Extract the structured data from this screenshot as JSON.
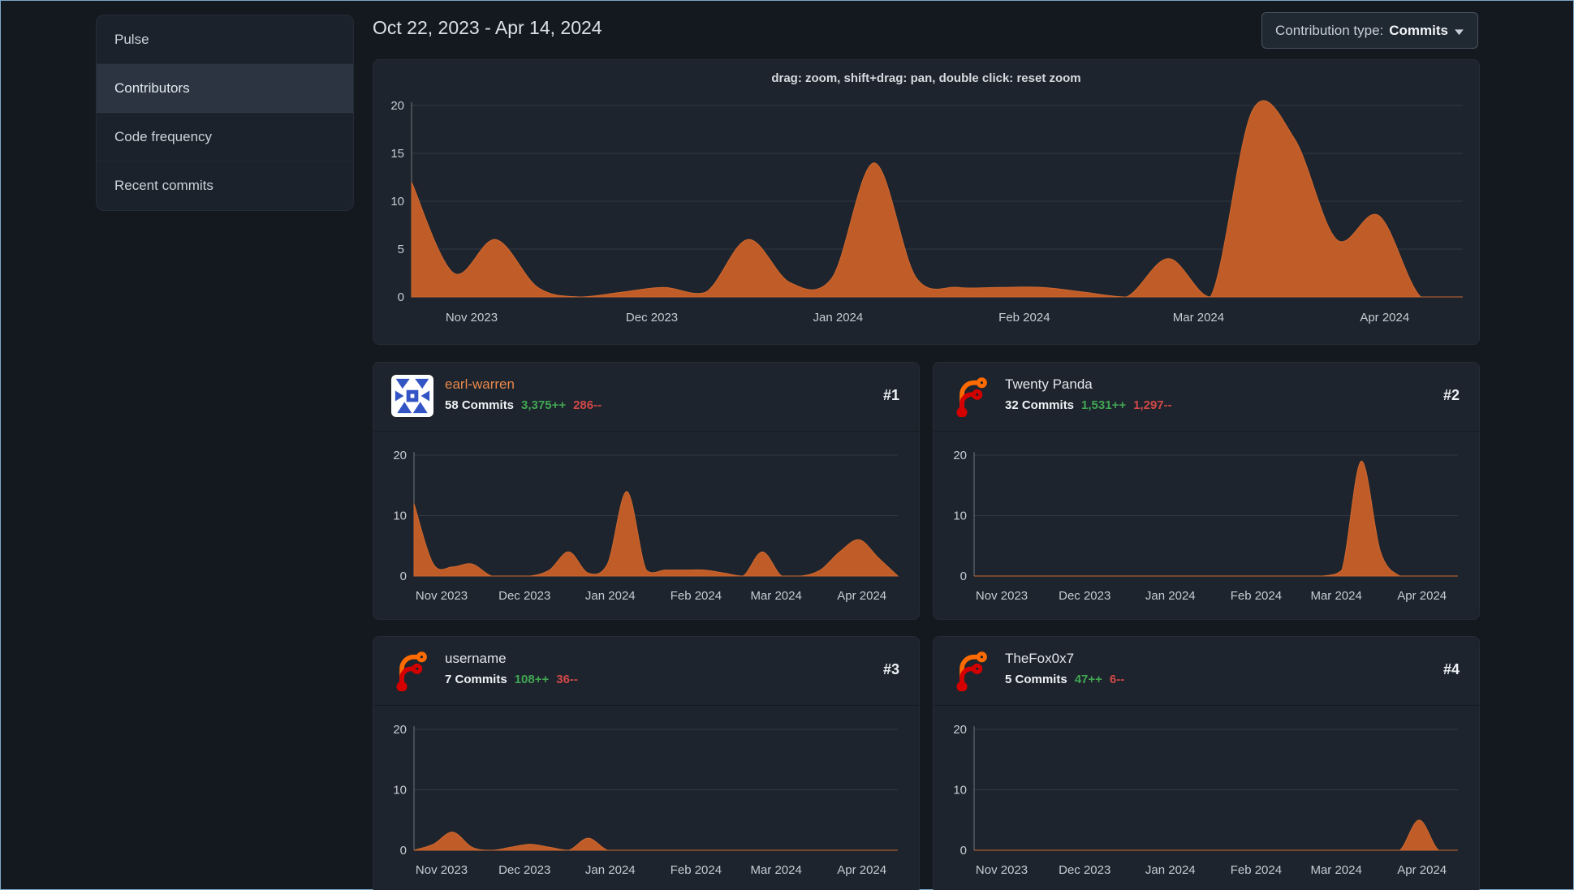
{
  "header": {
    "date_range": "Oct 22, 2023 - Apr 14, 2024",
    "contribution_type": {
      "label": "Contribution type:",
      "value": "Commits"
    }
  },
  "sidebar": {
    "items": [
      {
        "label": "Pulse",
        "active": false
      },
      {
        "label": "Contributors",
        "active": true
      },
      {
        "label": "Code frequency",
        "active": false
      },
      {
        "label": "Recent commits",
        "active": false
      }
    ]
  },
  "colors": {
    "area_fill": "#c05c28",
    "area_line": "#cd6830",
    "grid_line": "rgba(234,238,243,0.10)",
    "axis_line": "rgba(234,238,243,0.40)",
    "tick_text": "#c6ccd3",
    "additions_green": "#41a653",
    "deletions_red": "#d24848",
    "owner_link_orange": "#e9884b",
    "username_text": "#e2e6eb"
  },
  "chart_data": {
    "type": "area",
    "ylim": [
      0,
      20
    ],
    "x_axis_weeks": [
      "Oct 22",
      "Oct 29",
      "Nov 5",
      "Nov 12",
      "Nov 19",
      "Nov 26",
      "Dec 3",
      "Dec 10",
      "Dec 17",
      "Dec 24",
      "Dec 31",
      "Jan 7",
      "Jan 14",
      "Jan 21",
      "Jan 28",
      "Feb 4",
      "Feb 11",
      "Feb 18",
      "Feb 25",
      "Mar 3",
      "Mar 10",
      "Mar 17",
      "Mar 24",
      "Mar 31",
      "Apr 7",
      "Apr 14"
    ],
    "xlabels": [
      {
        "label": "Nov 2023",
        "f": 0.0571
      },
      {
        "label": "Dec 2023",
        "f": 0.2286
      },
      {
        "label": "Jan 2024",
        "f": 0.4057
      },
      {
        "label": "Feb 2024",
        "f": 0.5829
      },
      {
        "label": "Mar 2024",
        "f": 0.7486
      },
      {
        "label": "Apr 2024",
        "f": 0.9257
      }
    ],
    "main": {
      "title": "drag: zoom, shift+drag: pan, double click: reset zoom",
      "yticks": [
        0,
        5,
        10,
        15,
        20
      ],
      "values": [
        12,
        2.5,
        6,
        1,
        0,
        0.5,
        1,
        0.5,
        6,
        1.5,
        2,
        14,
        2,
        1,
        1,
        1,
        0.5,
        0,
        4,
        0,
        19.5,
        16.5,
        6,
        8.5,
        0,
        0
      ]
    },
    "contributors": [
      {
        "rank": "#1",
        "name": "earl-warren",
        "name_color": "#e9884b",
        "avatar": "identicon",
        "commits": "58 Commits",
        "additions": "3,375++",
        "deletions": "286--",
        "yticks": [
          0,
          10,
          20
        ],
        "values": [
          12,
          2,
          1.5,
          2,
          0,
          0,
          0,
          1,
          4,
          0.5,
          2,
          14,
          1,
          1,
          1,
          1,
          0.5,
          0,
          4,
          0,
          0,
          1,
          4,
          6,
          3,
          0
        ]
      },
      {
        "rank": "#2",
        "name": "Twenty Panda",
        "name_color": "#e2e6eb",
        "avatar": "forgejo",
        "commits": "32 Commits",
        "additions": "1,531++",
        "deletions": "1,297--",
        "yticks": [
          0,
          10,
          20
        ],
        "values": [
          0,
          0,
          0,
          0,
          0,
          0,
          0,
          0,
          0,
          0,
          0,
          0,
          0,
          0,
          0,
          0,
          0,
          0,
          0,
          1,
          19,
          4,
          0,
          0,
          0,
          0
        ]
      },
      {
        "rank": "#3",
        "name": "username",
        "name_color": "#e2e6eb",
        "avatar": "forgejo",
        "commits": "7 Commits",
        "additions": "108++",
        "deletions": "36--",
        "yticks": [
          0,
          10,
          20
        ],
        "values": [
          0,
          1,
          3,
          0.5,
          0,
          0.5,
          1,
          0.5,
          0,
          2,
          0,
          0,
          0,
          0,
          0,
          0,
          0,
          0,
          0,
          0,
          0,
          0,
          0,
          0,
          0,
          0
        ]
      },
      {
        "rank": "#4",
        "name": "TheFox0x7",
        "name_color": "#e2e6eb",
        "avatar": "forgejo",
        "commits": "5 Commits",
        "additions": "47++",
        "deletions": "6--",
        "yticks": [
          0,
          10,
          20
        ],
        "values": [
          0,
          0,
          0,
          0,
          0,
          0,
          0,
          0,
          0,
          0,
          0,
          0,
          0,
          0,
          0,
          0,
          0,
          0,
          0,
          0,
          0,
          0,
          0,
          5,
          0,
          0
        ]
      }
    ]
  }
}
